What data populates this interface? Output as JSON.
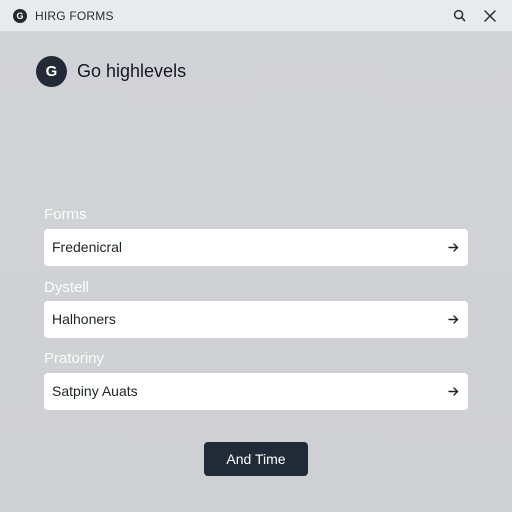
{
  "window": {
    "app_icon": "G",
    "title": "HIRG FORMS",
    "icons": [
      "search-icon",
      "close-icon"
    ]
  },
  "header": {
    "badge": "G",
    "title": "Go highlevels"
  },
  "sections": [
    {
      "label": "Forms",
      "item": "Fredenicral",
      "icon": "arrow-right-icon"
    },
    {
      "label": "Dystell",
      "item": "Halhoners",
      "icon": "arrow-right-icon"
    },
    {
      "label": "Pratoriny",
      "item": "Satpiny Auats",
      "icon": "arrow-right-icon"
    }
  ],
  "primary_button": {
    "label": "And Time"
  },
  "colors": {
    "background": "#d0d1d5",
    "titlebar": "#e9eaec",
    "accent_dark": "#212a37",
    "row_background": "#ffffff",
    "section_label": "#ffffff"
  }
}
